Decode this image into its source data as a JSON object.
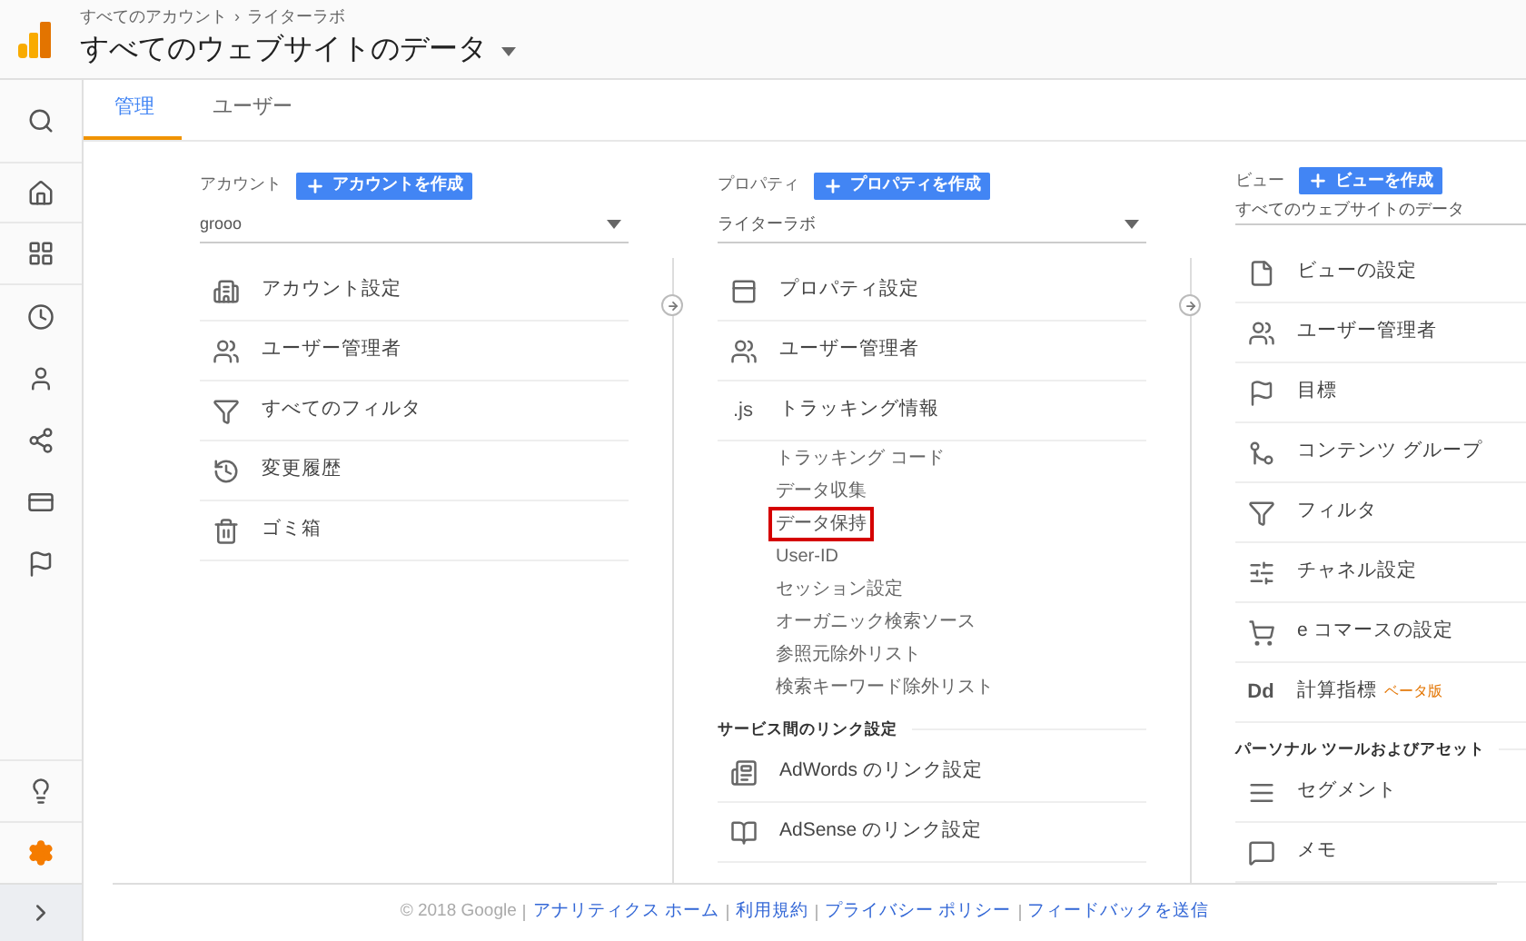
{
  "header": {
    "breadcrumb": [
      "すべてのアカウント",
      "ライターラボ"
    ],
    "breadcrumb_separator": "›",
    "title": "すべてのウェブサイトのデータ"
  },
  "sidebar": {
    "items": [
      {
        "selected": false
      },
      {
        "selected": false
      },
      {
        "selected": false
      },
      {
        "selected": false
      },
      {
        "selected": false
      },
      {
        "selected": false
      },
      {
        "selected": false
      },
      {
        "selected": false
      },
      {
        "selected": false
      },
      {
        "selected": true
      },
      {
        "selected": false
      }
    ]
  },
  "tabs": [
    {
      "label": "管理",
      "selected": true
    },
    {
      "label": "ユーザー",
      "selected": false
    }
  ],
  "columns": [
    {
      "label": "アカウント",
      "create_button": "アカウントを作成",
      "select": "grooo",
      "items": [
        {
          "kind": "row",
          "label": "アカウント設定"
        },
        {
          "kind": "row",
          "label": "ユーザー管理者"
        },
        {
          "kind": "row",
          "label": "すべてのフィルタ"
        },
        {
          "kind": "row",
          "label": "変更履歴"
        },
        {
          "kind": "row",
          "label": "ゴミ箱"
        }
      ]
    },
    {
      "label": "プロパティ",
      "create_button": "プロパティを作成",
      "select": "ライターラボ",
      "items": [
        {
          "kind": "row",
          "label": "プロパティ設定"
        },
        {
          "kind": "row",
          "label": "ユーザー管理者"
        },
        {
          "kind": "row",
          "label": "トラッキング情報",
          "icon_text": ".js"
        },
        {
          "kind": "subitem",
          "label": "トラッキング コード",
          "highlighted": false
        },
        {
          "kind": "subitem",
          "label": "データ収集",
          "highlighted": false
        },
        {
          "kind": "subitem",
          "label": "データ保持",
          "highlighted": true
        },
        {
          "kind": "subitem",
          "label": "User-ID",
          "highlighted": false
        },
        {
          "kind": "subitem",
          "label": "セッション設定",
          "highlighted": false
        },
        {
          "kind": "subitem",
          "label": "オーガニック検索ソース",
          "highlighted": false
        },
        {
          "kind": "subitem",
          "label": "参照元除外リスト",
          "highlighted": false
        },
        {
          "kind": "subitem",
          "label": "検索キーワード除外リスト",
          "highlighted": false
        },
        {
          "kind": "section",
          "label": "サービス間のリンク設定"
        },
        {
          "kind": "row",
          "label": "AdWords のリンク設定"
        },
        {
          "kind": "row",
          "label": "AdSense のリンク設定"
        }
      ]
    },
    {
      "label": "ビュー",
      "create_button": "ビューを作成",
      "select": "すべてのウェブサイトのデータ",
      "items": [
        {
          "kind": "row",
          "label": "ビューの設定"
        },
        {
          "kind": "row",
          "label": "ユーザー管理者"
        },
        {
          "kind": "row",
          "label": "目標"
        },
        {
          "kind": "row",
          "label": "コンテンツ グループ"
        },
        {
          "kind": "row",
          "label": "フィルタ"
        },
        {
          "kind": "row",
          "label": "チャネル設定"
        },
        {
          "kind": "row",
          "label": "e コマースの設定"
        },
        {
          "kind": "row",
          "label": "計算指標",
          "icon_text": "Dd",
          "badge": "ベータ版"
        },
        {
          "kind": "section",
          "label": "パーソナル ツールおよびアセット"
        },
        {
          "kind": "row",
          "label": "セグメント"
        },
        {
          "kind": "row",
          "label": "メモ"
        }
      ]
    }
  ],
  "footer": {
    "copyright": "© 2018 Google",
    "links": [
      "アナリティクス ホーム",
      "利用規約",
      "プライバシー ポリシー",
      "フィードバックを送信"
    ]
  }
}
